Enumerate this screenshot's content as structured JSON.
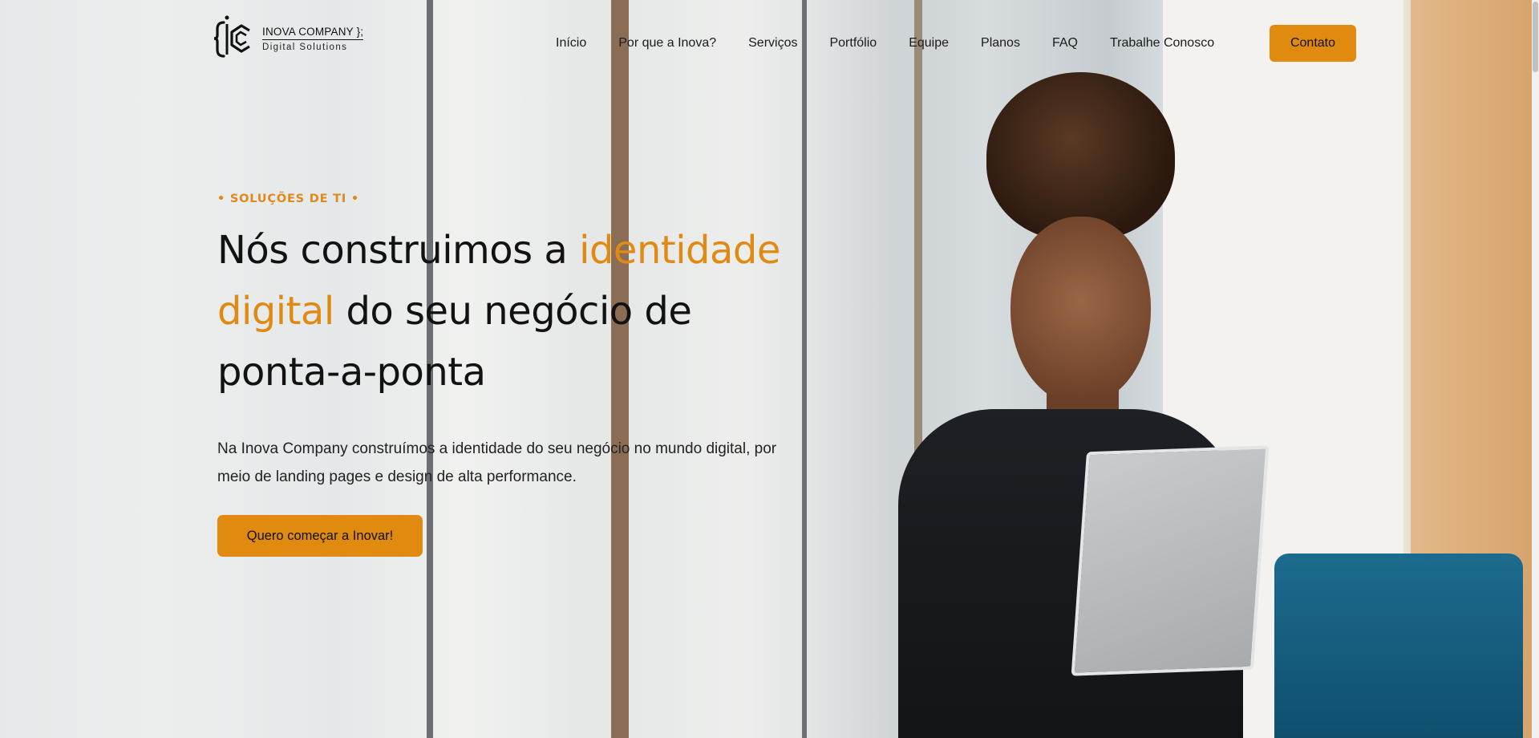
{
  "brand": {
    "name": "INOVA COMPANY };",
    "tagline": "Digital Solutions",
    "accent_color": "#e08a0f"
  },
  "nav": {
    "items": [
      "Início",
      "Por que a Inova?",
      "Serviços",
      "Portfólio",
      "Equipe",
      "Planos",
      "FAQ",
      "Trabalhe Conosco"
    ],
    "cta_label": "Contato"
  },
  "hero": {
    "eyebrow": "• SOLUÇÕES DE TI •",
    "headline_part1": "Nós construimos a ",
    "headline_accent1": "identidade",
    "headline_accent2": "digital",
    "headline_part2": " do seu negócio de",
    "headline_part3": "ponta-a-ponta",
    "description": "Na Inova Company construímos a identidade do seu negócio no mundo digital, por meio de landing pages e design de alta performance.",
    "button_label": "Quero começar a Inovar!"
  }
}
